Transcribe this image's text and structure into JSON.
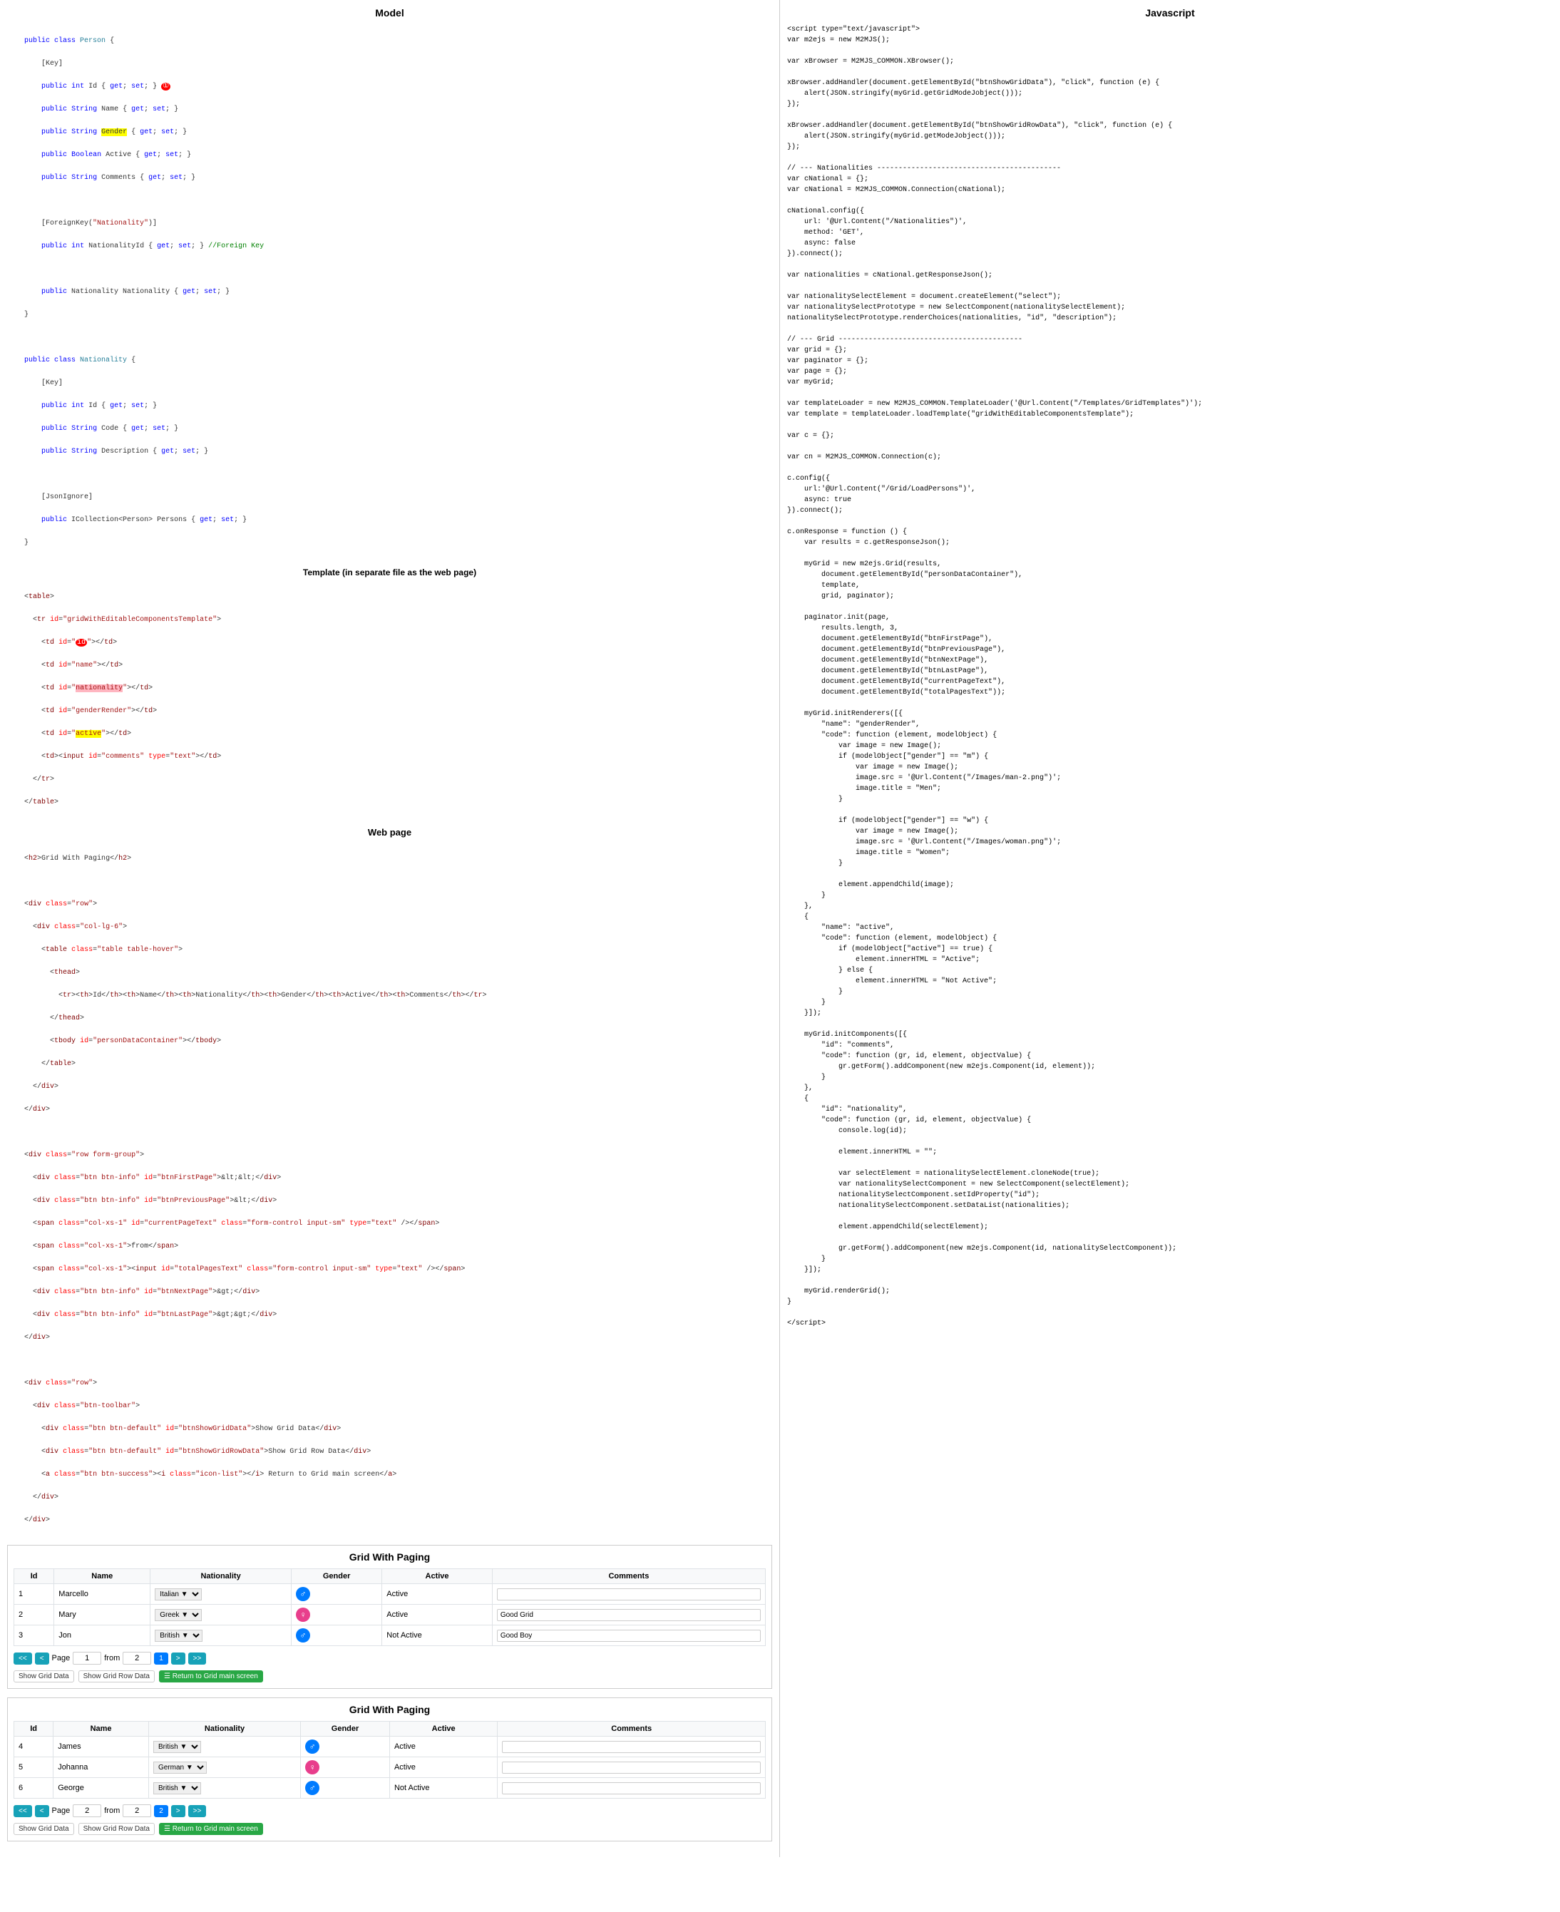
{
  "leftPanel": {
    "modelTitle": "Model",
    "modelCode": "public class Person {\n    [Key]\n    public int Id { get; set; }\n    public String Name { get; set; }\n    public String Gender { get; set; }\n    public Boolean Active { get; set; }\n    public String Comments { get; set; }\n\n    [ForeignKey(\"Nationality\")]\n    public int NationalityId { get; set; } //Foreign Key\n\n    public Nationality Nationality { get; set; }\n}\n\npublic class Nationality {\n    [Key]\n    public int Id { get; set; }\n    public String Code { get; set; }\n    public String Description { get; set; }\n\n    [JsonIgnore]\n    public ICollection<Person> Persons { get; set; }\n}",
    "templateLabel": "Template (in separate file as the web page)",
    "templateCode": "<table>\n  <tr id=\"gridWithEditableComponentsTemplate\">\n    <td id=\"id\"></td>\n    <td id=\"name\"></td>\n    <td id=\"nationality\"></td>\n    <td id=\"genderRender\"></td>\n    <td id=\"active\"></td>\n    <td><input id=\"comments\" type=\"text\"></td>\n  </tr>\n</table>",
    "webpageLabel": "Web page",
    "webpageHtmlTitle": "<h2>Grid With Paging</h2>",
    "webpageHtml": "<div class=\"row\">\n  <div class=\"col-lg-6\">\n    <table class=\"table table-hover\">\n      <thead>\n        <tr><th>Id</th><th>Name</th><th>Nationality</th><th>Gender</th><th>Active</th><th>Comments</th></tr>\n      </thead>\n      <tbody id=\"personDataContainer\"></tbody>\n    </table>\n  </div>\n</div>\n\n<div class=\"row form-group\">\n  <div class=\"btn btn-info\" id=\"btnFirstPage\">&lt;&lt;</div>\n  <div class=\"btn btn-info\" id=\"btnPreviousPage\">&lt;</div>\n  <span class=\"col-xs-1\" id=\"currentPageText\" class=\"form-control input-sm\" type=\"text\" /></span>\n  <span class=\"col-xs-1\">from</span>\n  <span class=\"col-xs-1\"><input id=\"totalPagesText\" class=\"form-control input-sm\" type=\"text\" /></span>\n  <div class=\"btn btn-info\" id=\"btnNextPage\">&gt;</div>\n  <div class=\"btn btn-info\" id=\"btnLastPage\">&gt;&gt;</div>\n</div>\n\n<div class=\"row\">\n  <div class=\"btn-toolbar\">\n    <div class=\"btn btn-default\" id=\"btnShowGridData\">Show Grid Data</div>\n    <div class=\"btn btn-default\" id=\"btnShowGridRowData\">Show Grid Row Data</div>\n    <a class=\"btn btn-success\" href=\"@Url.Content(\"~/Grid/Grid\")\"><i class=\"icon-list\"></i> Return to Grid main screen</a>\n  </div>\n</div>",
    "grids": [
      {
        "title": "Grid With Paging",
        "headers": [
          "Id",
          "Name",
          "Nationality",
          "Gender",
          "Active",
          "Comments"
        ],
        "rows": [
          {
            "id": "1",
            "name": "Marcello",
            "nationality": "Italian",
            "gender": "m",
            "active": "Active",
            "comment": ""
          },
          {
            "id": "2",
            "name": "Mary",
            "nationality": "Greek",
            "gender": "f",
            "active": "Active",
            "comment": "Good Grid"
          },
          {
            "id": "3",
            "name": "Jon",
            "nationality": "British",
            "gender": "m",
            "active": "Not Active",
            "comment": "Good Boy"
          }
        ],
        "pagination": {
          "currentPage": "1",
          "totalPages": "2",
          "fromLabel": "from"
        },
        "buttons": {
          "showGridData": "Show Grid Data",
          "showGridRowData": "Show Grid Row Data",
          "returnToMain": "Return to Grid main screen"
        }
      },
      {
        "title": "Grid With Paging",
        "headers": [
          "Id",
          "Name",
          "Nationality",
          "Gender",
          "Active",
          "Comments"
        ],
        "rows": [
          {
            "id": "4",
            "name": "James",
            "nationality": "British",
            "gender": "m",
            "active": "Active",
            "comment": ""
          },
          {
            "id": "5",
            "name": "Johanna",
            "nationality": "German",
            "gender": "f",
            "active": "Active",
            "comment": ""
          },
          {
            "id": "6",
            "name": "George",
            "nationality": "British",
            "gender": "m",
            "active": "Not Active",
            "comment": ""
          }
        ],
        "pagination": {
          "currentPage": "2",
          "totalPages": "2",
          "fromLabel": "from"
        },
        "buttons": {
          "showGridData": "Show Grid Data",
          "showGridRowData": "Show Grid Row Data",
          "returnToMain": "Return to Grid main screen"
        }
      }
    ]
  },
  "rightPanel": {
    "title": "Javascript",
    "code": "<script type=\"text/javascript\">\nvar m2ejs = new M2MJS();\n\nvar xBrowser = M2MJS_COMMON.XBrowser();\n\nxBrowser.addHandler(document.getElementById(\"btnShowGridData\"), \"click\", function (e) {\n    alert(JSON.stringify(myGrid.getGridModeJobject()));\n});\n\nxBrowser.addHandler(document.getElementById(\"btnShowGridRowData\"), \"click\", function (e) {\n    alert(JSON.stringify(myGrid.getModeJobject()));\n});\n\n// --- Nationalities -------------------------------------------\nvar cNational = {};\nvar cNational = M2MJS_COMMON.Connection(cNational);\n\ncNational.config({\n    url: '@Url.Content(\"/Nationalities\")',\n    method: 'GET',\n    async: false\n}).connect();\n\nvar nationalities = cNational.getResponseJson();\n\nvar nationalitySelectElement = document.createElement(\"select\");\nvar nationalitySelectPrototype = new SelectComponent(nationalitySelectElement);\nnationalitySelectPrototype.renderChoices(nationalities, \"id\", \"description\");\n\n// --- Grid -------------------------------------------\nvar grid = {};\nvar paginator = {};\nvar page = {};\nvar myGrid;\n\nvar templateLoader = new M2MJS_COMMON.TemplateLoader('@Url.Content(\"/Templates/GridTemplates\")');\nvar template = templateLoader.loadTemplate(\"gridWithEditableComponentsTemplate\");\n\nvar c = {};\n\nvar cn = M2MJS_COMMON.Connection(c);\n\nc.config({\n    url:'@Url.Content(\"/Grid/LoadPersons\")',\n    async: true\n}).connect();\n\nc.onResponse = function () {\n    var results = c.getResponseJson();\n\n    myGrid = new m2ejs.Grid(results,\n        document.getElementById(\"personDataContainer\"),\n        template,\n        grid, paginator);\n\n    paginator.init(page,\n        results.length, 3,\n        document.getElementById(\"btnFirstPage\"),\n        document.getElementById(\"btnPreviousPage\"),\n        document.getElementById(\"btnNextPage\"),\n        document.getElementById(\"btnLastPage\"),\n        document.getElementById(\"currentPageText\"),\n        document.getElementById(\"totalPagesText\"));\n\n    myGrid.initRenderers([{\n        \"name\": \"genderRender\",\n        \"code\": function (element, modelObject) {\n            var image = new Image();\n            if (modelObject[\"gender\"] == \"m\") {\n                var image = new Image();\n                image.src = '@Url.Content(\"/Images/man-2.png\")';\n                image.title = \"Men\";\n            }\n\n            if (modelObject[\"gender\"] == \"w\") {\n                var image = new Image();\n                image.src = '@Url.Content(\"/Images/woman.png\")';\n                image.title = \"Women\";\n            }\n\n            element.appendChild(image);\n        }\n    },\n    {\n        \"name\": \"active\",\n        \"code\": function (element, modelObject) {\n            if (modelObject[\"active\"] == true) {\n                element.innerHTML = \"Active\";\n            } else {\n                element.innerHTML = \"Not Active\";\n            }\n        }\n    }]);\n\n    myGrid.initComponents([{\n        \"id\": \"comments\",\n        \"code\": function (gr, id, element, objectValue) {\n            gr.getForm().addComponent(new m2ejs.Component(id, element));\n        }\n    },\n    {\n        \"id\": \"nationality\",\n        \"code\": function (gr, id, element, objectValue) {\n            console.log(id);\n\n            element.innerHTML = \"\";\n\n            var selectElement = nationalitySelectElement.cloneNode(true);\n            var nationalitySelectComponent = new SelectComponent(selectElement);\n            nationalitySelectComponent.setIdProperty(\"id\");\n            nationalitySelectComponent.setDataList(nationalities);\n\n            element.appendChild(selectElement);\n\n            gr.getForm().addComponent(new m2ejs.Component(id, nationalitySelectComponent));\n        }\n    }]);\n\n    myGrid.renderGrid();\n}\n\n</script>"
  }
}
